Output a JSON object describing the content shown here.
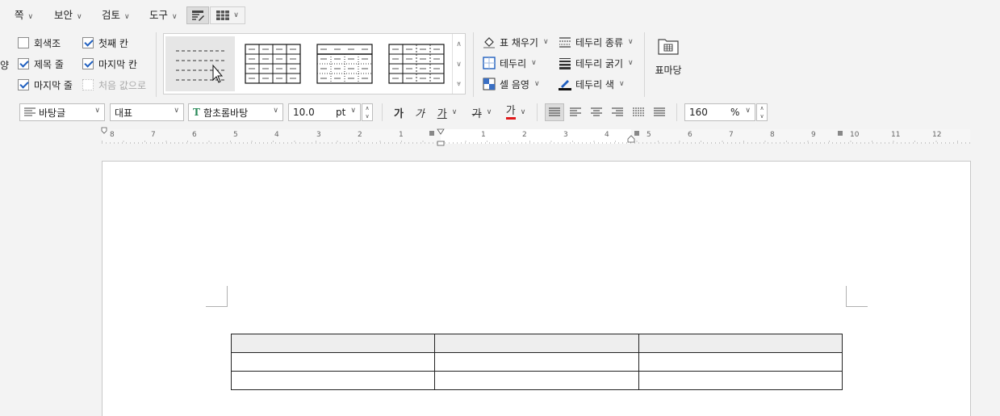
{
  "menu": {
    "items": [
      {
        "label": "쪽"
      },
      {
        "label": "보안"
      },
      {
        "label": "검토"
      },
      {
        "label": "도구"
      }
    ]
  },
  "table_options": {
    "cut_left_label": "양",
    "gray": "회색조",
    "first_col": "첫째 칸",
    "header_row": "제목 줄",
    "last_col": "마지막 칸",
    "last_row": "마지막 줄",
    "reset": "처음 값으로"
  },
  "table_tools": {
    "fill": "표 채우기",
    "border_type": "테두리 종류",
    "border": "테두리",
    "border_weight": "테두리 굵기",
    "cell_shade": "셀 음영",
    "border_color": "테두리 색",
    "table_mark": "표마당"
  },
  "format_bar": {
    "style": "바탕글",
    "style_icon": "paragraph-style-icon",
    "lang": "대표",
    "font": "함초롬바탕",
    "size": "10.0",
    "unit": "pt",
    "bold": "가",
    "italic": "가",
    "underline": "가",
    "strike": "가",
    "color": "가",
    "zoom": "160",
    "zoom_unit": "%"
  },
  "ruler": {
    "numbers": [
      "8",
      "7",
      "6",
      "5",
      "4",
      "3",
      "2",
      "1",
      "1",
      "2",
      "3",
      "4",
      "5",
      "6",
      "7",
      "8",
      "9",
      "10",
      "11",
      "12"
    ]
  },
  "colors": {
    "accent": "#1f5fbf",
    "text_red": "#e0191b"
  }
}
